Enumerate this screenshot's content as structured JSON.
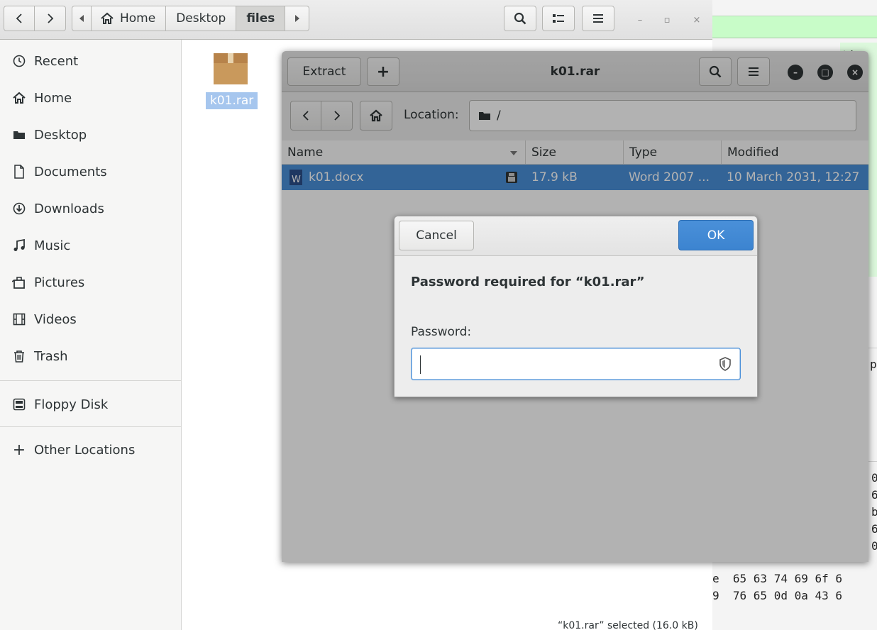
{
  "file_manager": {
    "path": [
      "Home",
      "Desktop",
      "files"
    ],
    "sidebar": [
      {
        "label": "Recent",
        "icon": "clock-icon"
      },
      {
        "label": "Home",
        "icon": "home-icon"
      },
      {
        "label": "Desktop",
        "icon": "folder-icon"
      },
      {
        "label": "Documents",
        "icon": "document-icon"
      },
      {
        "label": "Downloads",
        "icon": "download-icon"
      },
      {
        "label": "Music",
        "icon": "music-icon"
      },
      {
        "label": "Pictures",
        "icon": "camera-icon"
      },
      {
        "label": "Videos",
        "icon": "film-icon"
      },
      {
        "label": "Trash",
        "icon": "trash-icon"
      },
      {
        "label": "Floppy Disk",
        "icon": "drive-icon"
      },
      {
        "label": "Other Locations",
        "icon": "plus-icon"
      }
    ],
    "file_name": "k01.rar",
    "status": "“k01.rar” selected  (16.0 kB)"
  },
  "archive_manager": {
    "title": "k01.rar",
    "extract_label": "Extract",
    "add_label": "+",
    "location_label": "Location:",
    "location_value": "/",
    "columns": {
      "name": "Name",
      "size": "Size",
      "type": "Type",
      "modified": "Modified"
    },
    "rows": [
      {
        "name": "k01.docx",
        "size": "17.9 kB",
        "type": "Word 2007 ...",
        "modified": "10 March 2031, 12:27"
      }
    ]
  },
  "dialog": {
    "cancel": "Cancel",
    "ok": "OK",
    "message": "Password required for “k01.rar”",
    "password_label": "Password:",
    "password_value": ""
  },
  "background_window": {
    "hex_lines": [
      "e  65 63 74 69 6f 6",
      "9  76 65 0d 0a 43 6"
    ],
    "fragments": [
      "ti",
      "py",
      "0",
      "6",
      "b",
      "6",
      "0"
    ]
  },
  "colors": {
    "accent": "#4a90d9",
    "selection": "#a6c6ee",
    "archive_green": "#c8fcc8"
  }
}
